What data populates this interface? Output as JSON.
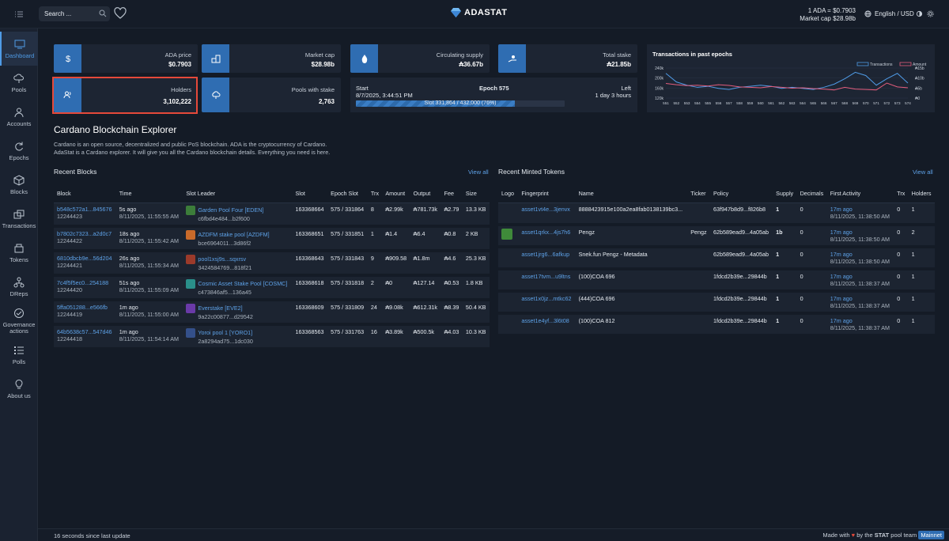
{
  "header": {
    "search_placeholder": "Search ...",
    "logo": "ADASTAT",
    "ada_price_line": "1 ADA = $0.7903",
    "market_cap_line": "Market cap $28.98b",
    "lang": "English / USD"
  },
  "sidebar": [
    {
      "label": "Dashboard",
      "icon": "dashboard-icon"
    },
    {
      "label": "Pools",
      "icon": "cloud-icon"
    },
    {
      "label": "Accounts",
      "icon": "user-icon"
    },
    {
      "label": "Epochs",
      "icon": "refresh-icon"
    },
    {
      "label": "Blocks",
      "icon": "cube-icon"
    },
    {
      "label": "Transactions",
      "icon": "transactions-icon"
    },
    {
      "label": "Tokens",
      "icon": "tokens-icon"
    },
    {
      "label": "DReps",
      "icon": "dreps-icon"
    },
    {
      "label": "Governance actions",
      "icon": "governance-icon"
    },
    {
      "label": "Polls",
      "icon": "polls-icon"
    },
    {
      "label": "About us",
      "icon": "lightbulb-icon"
    }
  ],
  "stats": {
    "ada_price": {
      "label": "ADA price",
      "value": "$0.7903"
    },
    "market_cap": {
      "label": "Market cap",
      "value": "$28.98b"
    },
    "circulating": {
      "label": "Circulating supply",
      "value": "₳36.67b"
    },
    "total_stake": {
      "label": "Total stake",
      "value": "₳21.85b"
    },
    "holders": {
      "label": "Holders",
      "value": "3,102,222"
    },
    "pools": {
      "label": "Pools with stake",
      "value": "2,763"
    }
  },
  "epoch": {
    "start_label": "Start",
    "start": "8/7/2025, 3:44:51 PM",
    "title": "Epoch 575",
    "left_label": "Left",
    "left": "1 day 3 hours",
    "slot_text": "Slot 331,864 / 432,000 (76%)",
    "progress": 0.76
  },
  "chart_data": {
    "type": "line",
    "title": "Transactions in past epochs",
    "x": [
      551,
      552,
      553,
      554,
      555,
      556,
      557,
      558,
      559,
      560,
      561,
      562,
      563,
      564,
      565,
      566,
      567,
      568,
      569,
      570,
      571,
      572,
      573,
      574
    ],
    "series": [
      {
        "name": "Transactions",
        "color": "#4f9be6",
        "values": [
          235,
          195,
          180,
          170,
          175,
          165,
          160,
          170,
          175,
          180,
          175,
          165,
          170,
          165,
          160,
          170,
          185,
          210,
          240,
          225,
          180,
          210,
          235,
          190
        ]
      },
      {
        "name": "Amount",
        "color": "#e35d7d",
        "values": [
          188,
          182,
          178,
          180,
          176,
          182,
          179,
          172,
          170,
          168,
          174,
          170,
          166,
          168,
          164,
          162,
          158,
          170,
          162,
          160,
          158,
          190,
          172,
          168
        ]
      }
    ],
    "y_ticks_left": [
      "240k",
      "200k",
      "160k",
      "120k"
    ],
    "y_ticks_right": [
      "₳15b",
      "₳10b",
      "₳5b",
      "₳0"
    ],
    "ylim": [
      120,
      260
    ]
  },
  "explorer": {
    "title": "Cardano Blockchain Explorer",
    "desc1": "Cardano is an open source, decentralized and public PoS blockchain. ADA is the cryptocurrency of Cardano.",
    "desc2": "AdaStat is a Cardano explorer. It will give you all the Cardano blockchain details. Everything you need is here."
  },
  "blocks": {
    "title": "Recent Blocks",
    "view_all": "View all",
    "columns": [
      "Block",
      "Time",
      "Slot Leader",
      "Slot",
      "Epoch Slot",
      "Trx",
      "Amount",
      "Output",
      "Fee",
      "Size"
    ],
    "rows": [
      {
        "hash": "b548c572a1...845676",
        "num": "12244423",
        "ago": "5s ago",
        "time": "8/11/2025, 11:55:55 AM",
        "pool": "Garden Pool Four [EDEN]",
        "pid": "c6fbd4e484...b2f600",
        "slot": "163368664",
        "eslot": "575 / 331864",
        "trx": "8",
        "amount": "₳2.99k",
        "output": "₳781.73k",
        "fee": "₳2.79",
        "size": "13.3 KB",
        "color": "#3c7d3a"
      },
      {
        "hash": "b7802c7323...a2d0c7",
        "num": "12244422",
        "ago": "18s ago",
        "time": "8/11/2025, 11:55:42 AM",
        "pool": "AZDFM stake pool [AZDFM]",
        "pid": "bce6964011...3d86f2",
        "slot": "163368651",
        "eslot": "575 / 331851",
        "trx": "1",
        "amount": "₳1.4",
        "output": "₳6.4",
        "fee": "₳0.8",
        "size": "2 KB",
        "color": "#c96a2a"
      },
      {
        "hash": "6810dbcb9e...56d204",
        "num": "12244421",
        "ago": "26s ago",
        "time": "8/11/2025, 11:55:34 AM",
        "pool": "pool1xsj9s...sqxrsv",
        "pid": "3424584769...818f21",
        "slot": "163368643",
        "eslot": "575 / 331843",
        "trx": "9",
        "amount": "₳909.58",
        "output": "₳1.8m",
        "fee": "₳4.6",
        "size": "25.3 KB",
        "color": "#9b3a2a"
      },
      {
        "hash": "7c4f5f5ec0...254188",
        "num": "12244420",
        "ago": "51s ago",
        "time": "8/11/2025, 11:55:09 AM",
        "pool": "Cosmic Asset Stake Pool [COSMC]",
        "pid": "c473846af5...136a45",
        "slot": "163368618",
        "eslot": "575 / 331818",
        "trx": "2",
        "amount": "₳0",
        "output": "₳127.14",
        "fee": "₳0.53",
        "size": "1.8 KB",
        "color": "#2a8f8a"
      },
      {
        "hash": "5ffa051288...e566fb",
        "num": "12244419",
        "ago": "1m ago",
        "time": "8/11/2025, 11:55:00 AM",
        "pool": "Everstake [EVE2]",
        "pid": "9a22c00877...d29542",
        "slot": "163368609",
        "eslot": "575 / 331809",
        "trx": "24",
        "amount": "₳9.08k",
        "output": "₳612.31k",
        "fee": "₳8.39",
        "size": "50.4 KB",
        "color": "#6a3aa8"
      },
      {
        "hash": "64b5638c57...547d46",
        "num": "12244418",
        "ago": "1m ago",
        "time": "8/11/2025, 11:54:14 AM",
        "pool": "Yoroi pool 1 [YORO1]",
        "pid": "2a8294ad75...1dc030",
        "slot": "163368563",
        "eslot": "575 / 331763",
        "trx": "16",
        "amount": "₳3.89k",
        "output": "₳500.5k",
        "fee": "₳4.03",
        "size": "10.3 KB",
        "color": "#34508a"
      }
    ]
  },
  "tokens": {
    "title": "Recent Minted Tokens",
    "view_all": "View all",
    "columns": [
      "Logo",
      "Fingerprint",
      "Name",
      "Ticker",
      "Policy",
      "Supply",
      "Decimals",
      "First Activity",
      "Trx",
      "Holders"
    ],
    "rows": [
      {
        "fp": "asset1vt4e...3jenvx",
        "name": "8888423915e100a2ea8fab0138139bc3...",
        "ticker": "",
        "policy": "63f947b8d9...f826b8",
        "supply": "1",
        "dec": "0",
        "ago": "17m ago",
        "time": "8/11/2025, 11:38:50 AM",
        "trx": "0",
        "holders": "1",
        "logo": false
      },
      {
        "fp": "asset1qrkx...4js7h6",
        "name": "Pengz",
        "ticker": "Pengz",
        "policy": "62b589ead9...4a05ab",
        "supply": "1b",
        "dec": "0",
        "ago": "17m ago",
        "time": "8/11/2025, 11:38:50 AM",
        "trx": "0",
        "holders": "2",
        "logo": true
      },
      {
        "fp": "asset1jrg6...6afkup",
        "name": "Snek.fun Pengz - Metadata",
        "ticker": "",
        "policy": "62b589ead9...4a05ab",
        "supply": "1",
        "dec": "0",
        "ago": "17m ago",
        "time": "8/11/2025, 11:38:50 AM",
        "trx": "0",
        "holders": "1",
        "logo": false
      },
      {
        "fp": "asset17tvm...u9ltns",
        "name": "(100)COA 696",
        "ticker": "",
        "policy": "1fdcd2b39e...29844b",
        "supply": "1",
        "dec": "0",
        "ago": "17m ago",
        "time": "8/11/2025, 11:38:37 AM",
        "trx": "0",
        "holders": "1",
        "logo": false
      },
      {
        "fp": "asset1x0jz...mtkc62",
        "name": "(444)COA 696",
        "ticker": "",
        "policy": "1fdcd2b39e...29844b",
        "supply": "1",
        "dec": "0",
        "ago": "17m ago",
        "time": "8/11/2025, 11:38:37 AM",
        "trx": "0",
        "holders": "1",
        "logo": false
      },
      {
        "fp": "asset1e4yf...3l6t08",
        "name": "(100)COA 812",
        "ticker": "",
        "policy": "1fdcd2b39e...29844b",
        "supply": "1",
        "dec": "0",
        "ago": "17m ago",
        "time": "8/11/2025, 11:38:37 AM",
        "trx": "0",
        "holders": "1",
        "logo": false
      }
    ]
  },
  "footer": {
    "left": "16 seconds since last update",
    "made": "Made with",
    "by": "by the",
    "stat": "STAT",
    "team": "pool team",
    "network": "Mainnet"
  }
}
